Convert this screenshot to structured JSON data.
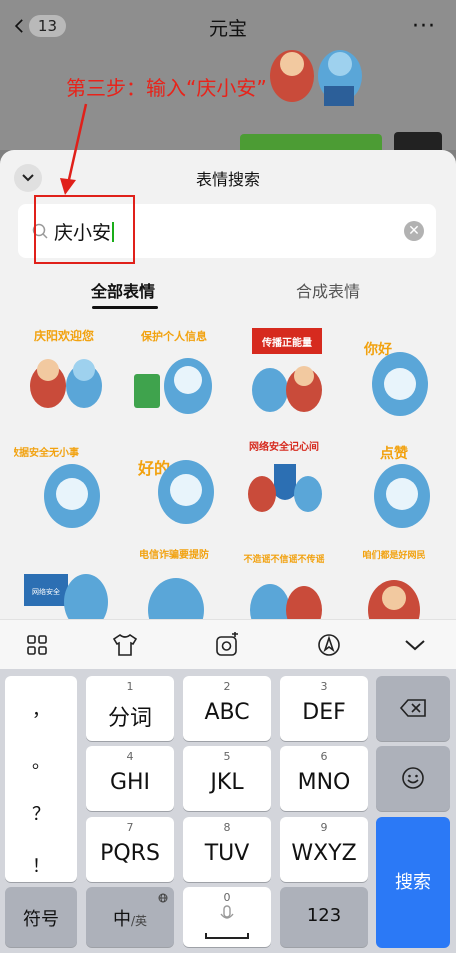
{
  "chat": {
    "back_count": "13",
    "title": "元宝",
    "more": "···"
  },
  "annotation": {
    "step_text": "第三步：输入“庆小安”",
    "color": "#e8231a"
  },
  "panel": {
    "title": "表情搜索",
    "search_value": "庆小安",
    "tabs": [
      "全部表情",
      "合成表情"
    ],
    "active_tab": "全部表情"
  },
  "stickers": [
    {
      "label": "庆阳欢迎您"
    },
    {
      "label": "保护个人信息"
    },
    {
      "label": "传播正能量"
    },
    {
      "label": "你好"
    },
    {
      "label": "数据安全无小事"
    },
    {
      "label": "好的"
    },
    {
      "label": "网络安全记心间"
    },
    {
      "label": "点赞"
    },
    {
      "label": "网络安全"
    },
    {
      "label": "电信诈骗要提防"
    },
    {
      "label": "不造谣不信谣不传谣"
    },
    {
      "label": "咱们都是好网民"
    }
  ],
  "toolbar": {
    "icons": [
      "grid-icon",
      "shirt-icon",
      "sticker-camera-icon",
      "pen-nib-icon",
      "chevron-down-icon"
    ]
  },
  "keyboard": {
    "punct": [
      "，",
      "。",
      "？",
      "！"
    ],
    "rows": [
      [
        {
          "num": "1",
          "label": "分词"
        },
        {
          "num": "2",
          "label": "ABC"
        },
        {
          "num": "3",
          "label": "DEF"
        }
      ],
      [
        {
          "num": "4",
          "label": "GHI"
        },
        {
          "num": "5",
          "label": "JKL"
        },
        {
          "num": "6",
          "label": "MNO"
        }
      ],
      [
        {
          "num": "7",
          "label": "PQRS"
        },
        {
          "num": "8",
          "label": "TUV"
        },
        {
          "num": "9",
          "label": "WXYZ"
        }
      ]
    ],
    "symbol": "符号",
    "lang_main": "中",
    "lang_sub": "/英",
    "space_num": "0",
    "num_key": "123",
    "search": "搜索",
    "accent": "#2b79f6"
  }
}
